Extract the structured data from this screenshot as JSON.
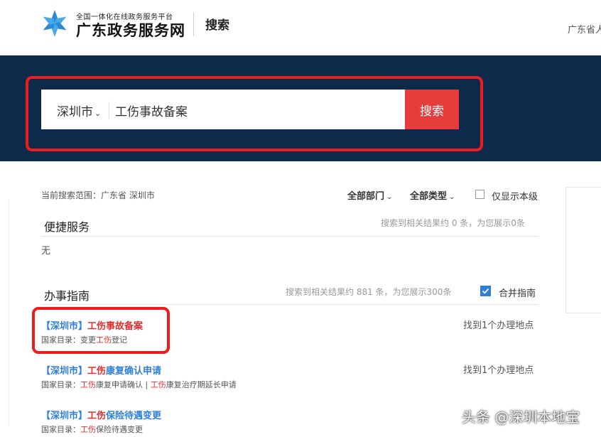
{
  "header": {
    "logo_small": "全国一体化在线政务服务平台",
    "logo_big": "广东政务服务网",
    "nav_search": "搜索",
    "region_text": "广东省人"
  },
  "search": {
    "region": "深圳市",
    "query": "工伤事故备案",
    "button": "搜索"
  },
  "filters": {
    "scope": "当前搜索范围：广东省 深圳市",
    "department": "全部部门",
    "type": "全部类型",
    "local_only_label": "仅显示本级",
    "local_only_checked": false
  },
  "quick": {
    "title": "便捷服务",
    "count": "搜索到相关结果约 0 条，为您展示0条",
    "empty": "无"
  },
  "guide": {
    "title": "办事指南",
    "count": "搜索到相关结果约 881 条，为您展示300条",
    "merge_label": "合并指南",
    "merge_checked": true,
    "items": [
      {
        "region": "【深圳市】",
        "kw": "工伤",
        "rest": "事故备案",
        "cat_prefix": "国家目录：",
        "cat_parts": [
          {
            "t": "变更",
            "k": false
          },
          {
            "t": "工伤",
            "k": true
          },
          {
            "t": "登记",
            "k": false
          }
        ],
        "loc": "找到1个办理地点"
      },
      {
        "region": "【深圳市】",
        "kw": "工伤",
        "rest": "康复确认申请",
        "cat_prefix": "国家目录：",
        "cat_parts": [
          {
            "t": "工伤",
            "k": true
          },
          {
            "t": "康复申请确认 | ",
            "k": false
          },
          {
            "t": "工伤",
            "k": true
          },
          {
            "t": "康复治疗期延长申请",
            "k": false
          }
        ],
        "loc": "找到1个办理地点"
      },
      {
        "region": "【深圳市】",
        "kw": "工伤",
        "rest": "保险待遇变更",
        "cat_prefix": "国家目录：",
        "cat_parts": [
          {
            "t": "工伤",
            "k": true
          },
          {
            "t": "保险待遇变更",
            "k": false
          }
        ],
        "loc": ""
      }
    ]
  },
  "watermark": "头条 @深圳本地宝",
  "colors": {
    "banner": "#0e2a4a",
    "accent_red": "#e83b3b",
    "link_blue": "#2f7fd8",
    "highlight_red": "#e03030"
  }
}
